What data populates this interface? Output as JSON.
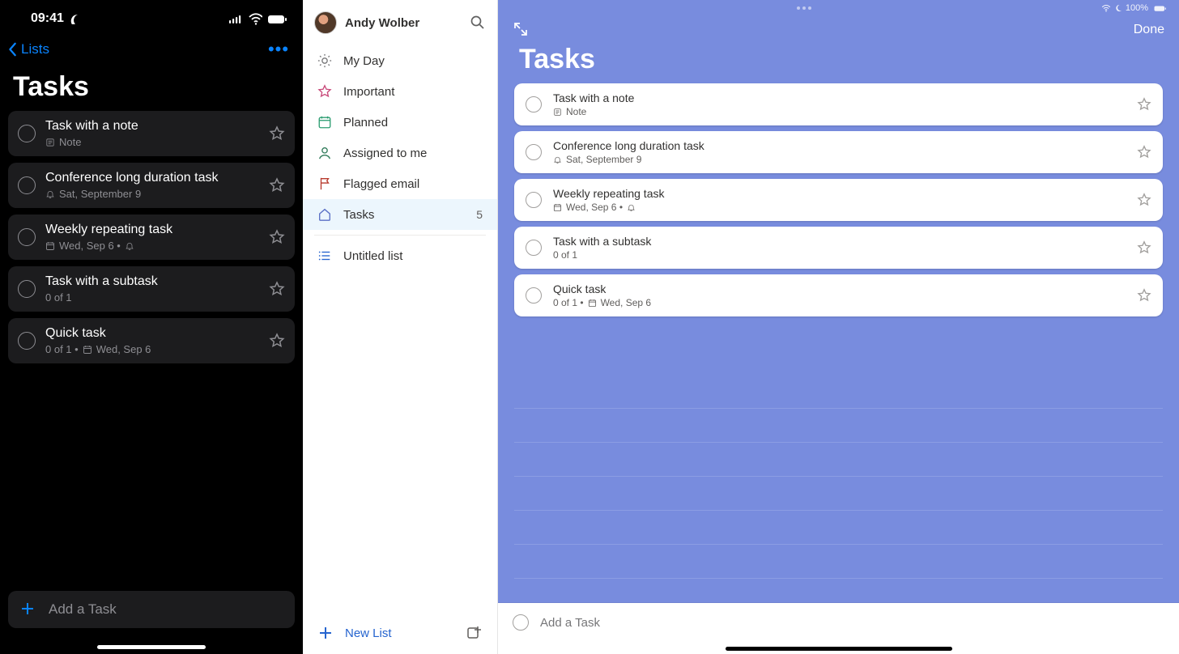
{
  "phone": {
    "status_time": "09:41",
    "back_label": "Lists",
    "title": "Tasks",
    "add_task_label": "Add a Task",
    "tasks": [
      {
        "title": "Task with a note",
        "sub_icon": "note-icon",
        "sub_text": "Note"
      },
      {
        "title": "Conference long duration task",
        "sub_icon": "bell-icon",
        "sub_text": "Sat, September 9"
      },
      {
        "title": "Weekly repeating task",
        "sub_icon": "calendar-icon",
        "sub_text": "Wed, Sep 6  •",
        "trail_icon": "bell-icon"
      },
      {
        "title": "Task with a subtask",
        "sub_icon": "",
        "sub_text": "0 of 1"
      },
      {
        "title": "Quick task",
        "sub_icon": "",
        "sub_text": "0 of 1  •",
        "trail_icon": "calendar-icon",
        "trail_text": "Wed, Sep 6"
      }
    ]
  },
  "sidebar": {
    "user_name": "Andy Wolber",
    "new_list_label": "New List",
    "items": [
      {
        "icon": "sun",
        "label": "My Day",
        "color": "#767678"
      },
      {
        "icon": "star",
        "label": "Important",
        "color": "#c94b7b"
      },
      {
        "icon": "calendar",
        "label": "Planned",
        "color": "#2f9e73"
      },
      {
        "icon": "person",
        "label": "Assigned to me",
        "color": "#2f7a59"
      },
      {
        "icon": "flag",
        "label": "Flagged email",
        "color": "#b83b2e"
      },
      {
        "icon": "home",
        "label": "Tasks",
        "color": "#5b70c6",
        "count": "5",
        "selected": true
      }
    ],
    "lists": [
      {
        "icon": "list",
        "label": "Untitled list"
      }
    ]
  },
  "content": {
    "status_battery": "100%",
    "done_label": "Done",
    "title": "Tasks",
    "add_placeholder": "Add a Task",
    "tasks": [
      {
        "title": "Task with a note",
        "sub_icon": "note-icon",
        "sub_text": "Note"
      },
      {
        "title": "Conference long duration task",
        "sub_icon": "bell-icon",
        "sub_text": "Sat, September 9"
      },
      {
        "title": "Weekly repeating task",
        "sub_icon": "calendar-icon",
        "sub_text": "Wed, Sep 6  •",
        "trail_icon": "bell-icon"
      },
      {
        "title": "Task with a subtask",
        "sub_icon": "",
        "sub_text": "0 of 1"
      },
      {
        "title": "Quick task",
        "sub_icon": "",
        "sub_text": "0 of 1  •",
        "trail_icon": "calendar-icon",
        "trail_text": "Wed, Sep 6"
      }
    ]
  }
}
